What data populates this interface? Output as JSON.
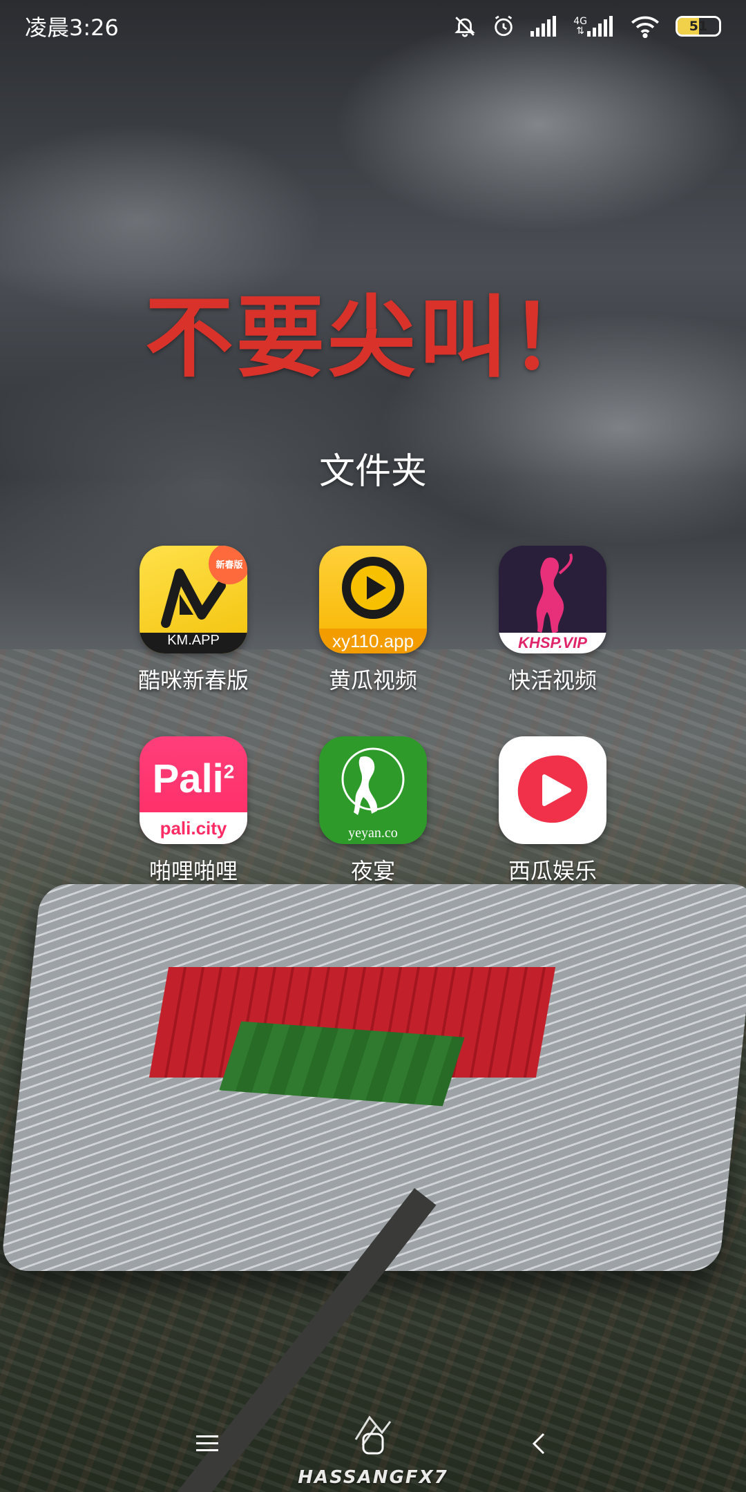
{
  "status_bar": {
    "time": "凌晨3:26",
    "network_label_top": "4G",
    "network_label_bottom": "⇅",
    "battery_level": "51",
    "battery_fraction": 0.51,
    "icons": [
      "mute-bell-icon",
      "alarm-icon",
      "signal-icon",
      "signal-4g-icon",
      "wifi-icon",
      "battery-icon"
    ]
  },
  "wallpaper": {
    "slogan": "不要尖叫！",
    "slogan_color": "#d8322a"
  },
  "folder": {
    "title": "文件夹",
    "apps": [
      {
        "label": "酷咪新春版",
        "icon_text": "KM.APP",
        "badge": "新春版",
        "icon": "km-app-icon"
      },
      {
        "label": "黄瓜视频",
        "icon_text": "xy110.app",
        "icon": "huanggua-video-icon"
      },
      {
        "label": "快活视频",
        "icon_text": "KHSP.VIP",
        "icon": "kuaihuo-video-icon"
      },
      {
        "label": "啪哩啪哩",
        "icon_text": "Pali",
        "icon_sup": "2",
        "icon_caption": "pali.city",
        "icon": "pali-icon"
      },
      {
        "label": "夜宴",
        "icon_text": "yeyan.co",
        "icon": "yeyan-icon"
      },
      {
        "label": "西瓜娱乐",
        "icon": "xigua-icon"
      }
    ]
  },
  "nav_bar": {
    "buttons": [
      "menu-icon",
      "home-icon",
      "back-icon"
    ]
  },
  "watermark": {
    "text": "HASSANGFX7"
  }
}
